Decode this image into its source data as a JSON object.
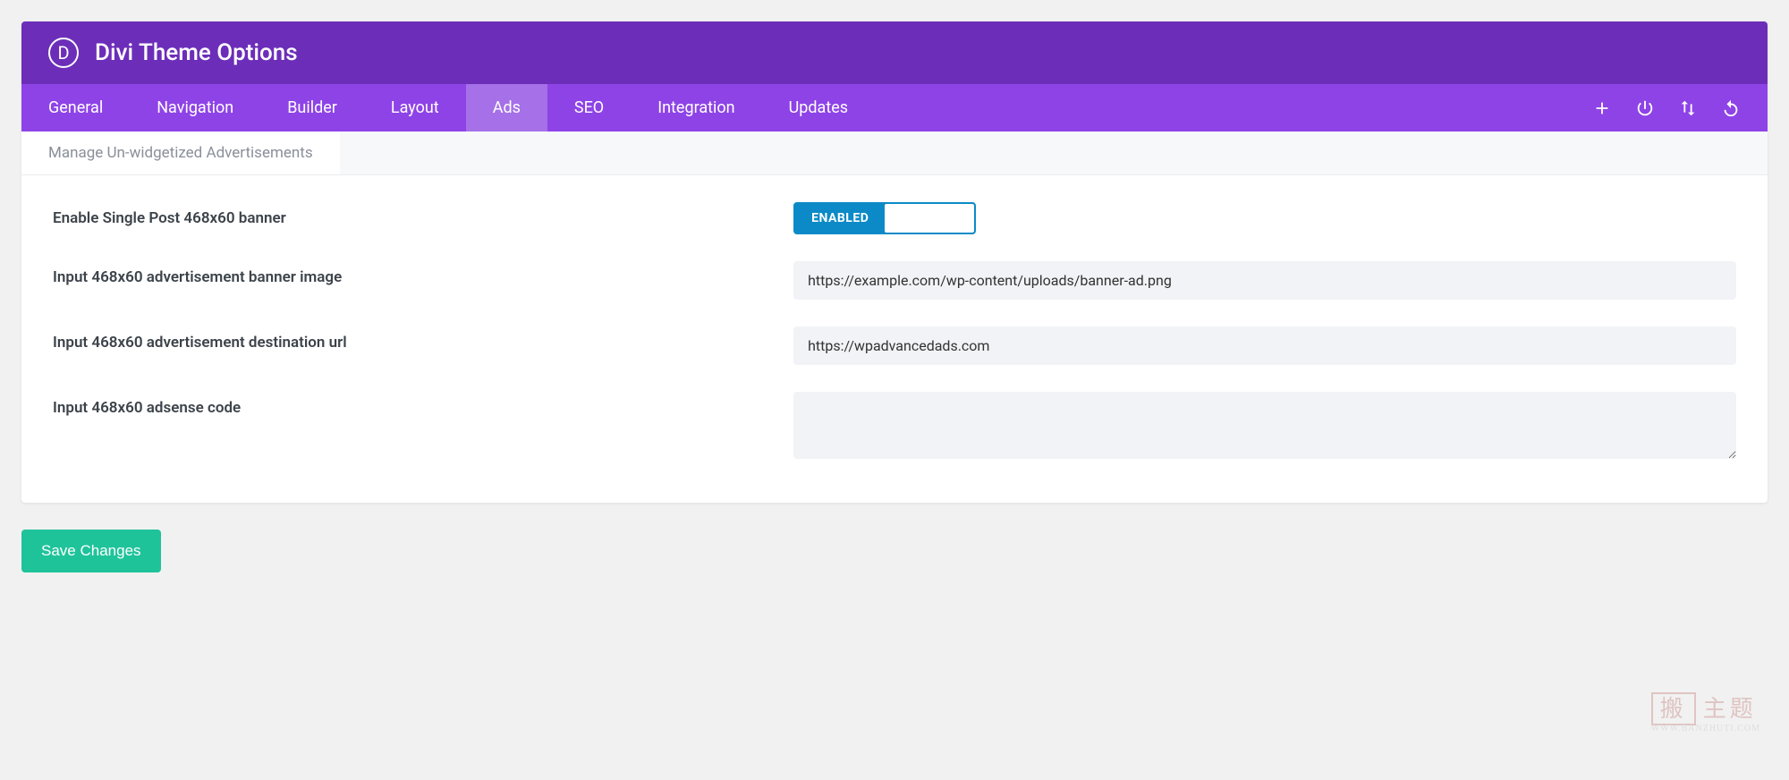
{
  "header": {
    "logo_letter": "D",
    "title": "Divi Theme Options"
  },
  "tabs": [
    {
      "label": "General",
      "active": false
    },
    {
      "label": "Navigation",
      "active": false
    },
    {
      "label": "Builder",
      "active": false
    },
    {
      "label": "Layout",
      "active": false
    },
    {
      "label": "Ads",
      "active": true
    },
    {
      "label": "SEO",
      "active": false
    },
    {
      "label": "Integration",
      "active": false
    },
    {
      "label": "Updates",
      "active": false
    }
  ],
  "subnav": {
    "label": "Manage Un-widgetized Advertisements"
  },
  "fields": {
    "enable_banner": {
      "label": "Enable Single Post 468x60 banner",
      "toggle_text": "ENABLED",
      "value": true
    },
    "banner_image": {
      "label": "Input 468x60 advertisement banner image",
      "value": "https://example.com/wp-content/uploads/banner-ad.png"
    },
    "destination_url": {
      "label": "Input 468x60 advertisement destination url",
      "value": "https://wpadvancedads.com"
    },
    "adsense_code": {
      "label": "Input 468x60 adsense code",
      "value": ""
    }
  },
  "save_button": "Save Changes",
  "watermark": {
    "stamp": "搬",
    "text": "主题",
    "url": "WWW.BANZHUTI.COM"
  }
}
